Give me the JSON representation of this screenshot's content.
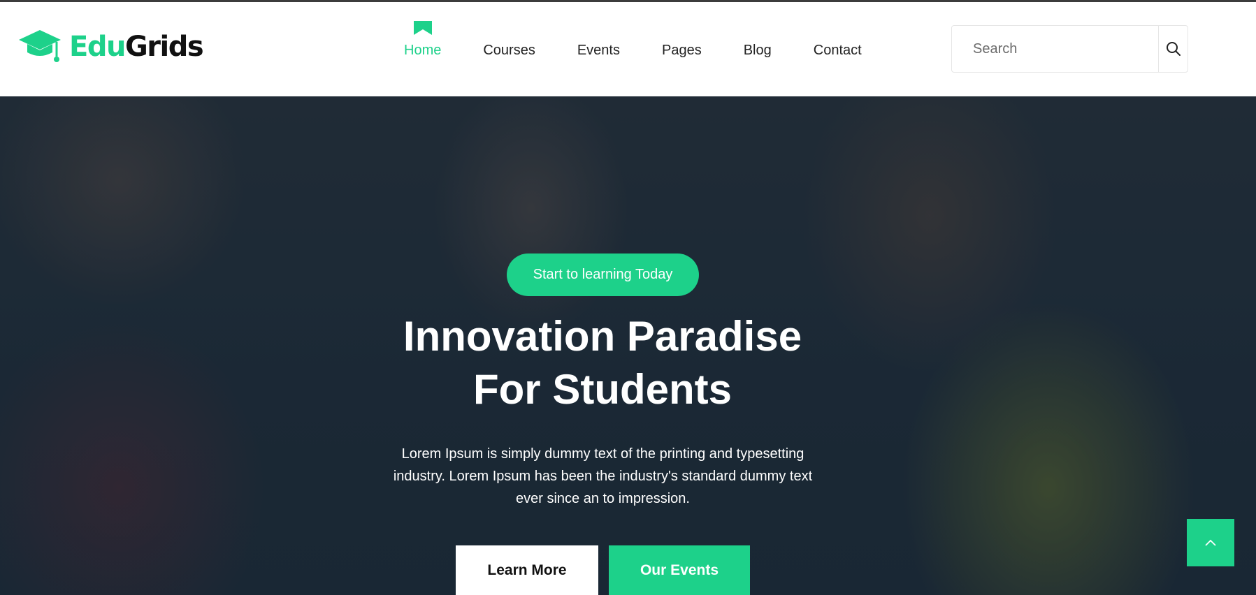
{
  "brand": {
    "name_part1": "Edu",
    "name_part2": "Grids",
    "accent_color": "#1dd18a"
  },
  "nav": {
    "items": [
      {
        "label": "Home",
        "active": true
      },
      {
        "label": "Courses"
      },
      {
        "label": "Events"
      },
      {
        "label": "Pages"
      },
      {
        "label": "Blog"
      },
      {
        "label": "Contact"
      }
    ]
  },
  "search": {
    "placeholder": "Search",
    "icon": "search-icon"
  },
  "hero": {
    "badge": "Start to learning Today",
    "title_line1": "Innovation Paradise",
    "title_line2": "For Students",
    "description": "Lorem Ipsum is simply dummy text of the printing and typesetting industry. Lorem Ipsum has been the industry's standard dummy text ever since an to impression.",
    "primary_button": "Learn More",
    "secondary_button": "Our Events"
  },
  "scroll_top": {
    "icon": "chevron-up-icon"
  }
}
